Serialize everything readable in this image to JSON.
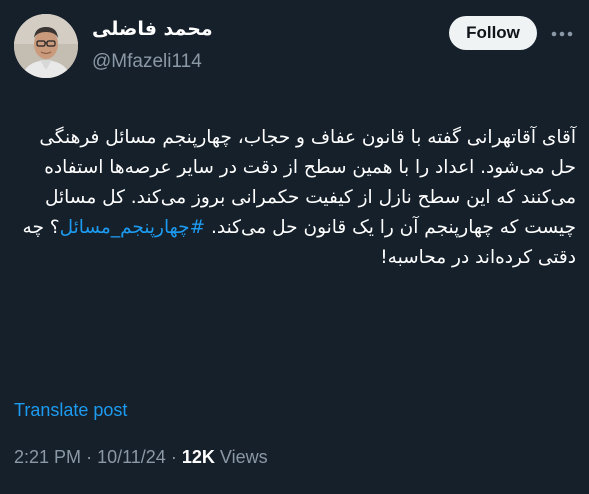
{
  "author": {
    "display_name": "محمد فاضلی",
    "handle": "@Mfazeli114"
  },
  "actions": {
    "follow_label": "Follow",
    "more_icon": "more-horizontal-icon"
  },
  "tweet": {
    "text_before_hashtag": "آقای آقاتهرانی گفته با قانون عفاف و حجاب، چهارپنجم مسائل فرهنگی حل می‌شود. اعداد را با همین سطح از دقت در سایر عرصه‌ها استفاده می‌کنند که این سطح نازل از کیفیت حکمرانی بروز می‌کند. کل مسائل چیست که چهارپنجم آن را یک قانون حل می‌کند. ",
    "hashtag": "#چهارپنجم_مسائل",
    "text_after_hashtag": "؟ چه دقتی کرده‌اند در محاسبه!"
  },
  "translate_label": "Translate post",
  "meta": {
    "time": "2:21 PM",
    "separator": "·",
    "date": "10/11/24",
    "views_count": "12K",
    "views_label": "Views"
  },
  "colors": {
    "background": "#15202b",
    "accent": "#1d9bf0",
    "secondary_text": "#8b98a5",
    "follow_button_bg": "#eff3f4"
  }
}
